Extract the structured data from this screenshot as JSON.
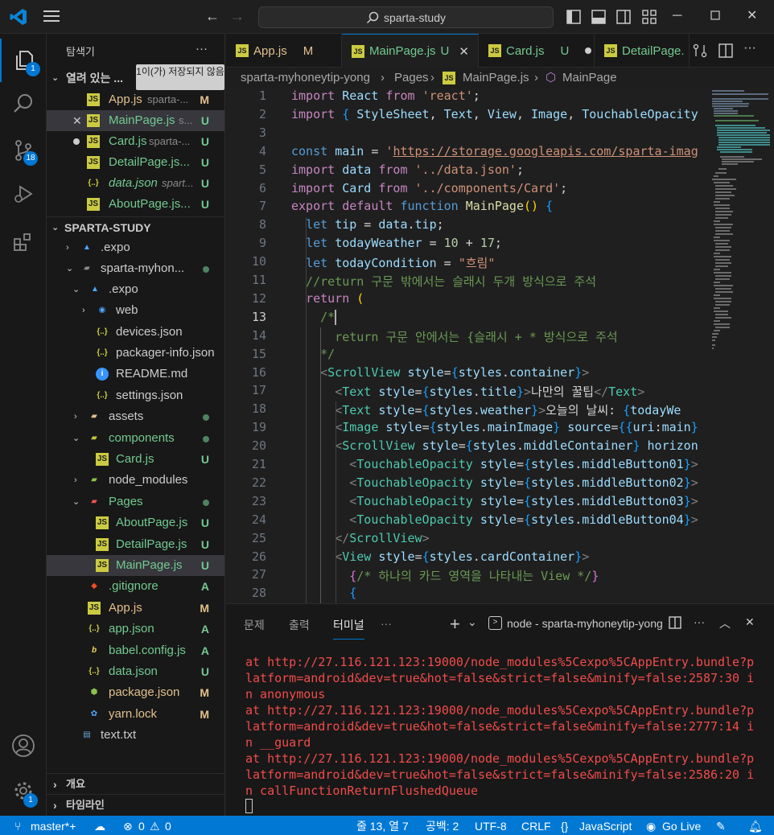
{
  "titlebar": {
    "search": "sparta-study"
  },
  "activity": {
    "explorer_badge": "1",
    "scm_badge": "18",
    "settings_badge": "1"
  },
  "sidebar": {
    "title": "탐색기",
    "more": "···",
    "open_editors": "열려 있는 ...",
    "unsaved_tooltip": "1이(가) 저장되지 않음",
    "open_items": [
      {
        "name": "App.js",
        "path": "sparta-...",
        "status": "M"
      },
      {
        "name": "MainPage.js",
        "path": "s...",
        "status": "U"
      },
      {
        "name": "Card.js",
        "path": "sparta-...",
        "status": "U"
      },
      {
        "name": "DetailPage.js...",
        "path": "",
        "status": "U"
      },
      {
        "name": "data.json",
        "path": "spart...",
        "status": "U"
      },
      {
        "name": "AboutPage.js...",
        "path": "",
        "status": "U"
      }
    ],
    "project": "SPARTA-STUDY",
    "tree": [
      {
        "name": ".expo",
        "status": ""
      },
      {
        "name": "sparta-myhon...",
        "status": ""
      },
      {
        "name": ".expo",
        "status": ""
      },
      {
        "name": "web",
        "status": ""
      },
      {
        "name": "devices.json",
        "status": ""
      },
      {
        "name": "packager-info.json",
        "status": ""
      },
      {
        "name": "README.md",
        "status": ""
      },
      {
        "name": "settings.json",
        "status": ""
      },
      {
        "name": "assets",
        "status": ""
      },
      {
        "name": "components",
        "status": ""
      },
      {
        "name": "Card.js",
        "status": "U"
      },
      {
        "name": "node_modules",
        "status": ""
      },
      {
        "name": "Pages",
        "status": ""
      },
      {
        "name": "AboutPage.js",
        "status": "U"
      },
      {
        "name": "DetailPage.js",
        "status": "U"
      },
      {
        "name": "MainPage.js",
        "status": "U"
      },
      {
        "name": ".gitignore",
        "status": "A"
      },
      {
        "name": "App.js",
        "status": "M"
      },
      {
        "name": "app.json",
        "status": "A"
      },
      {
        "name": "babel.config.js",
        "status": "A"
      },
      {
        "name": "data.json",
        "status": "U"
      },
      {
        "name": "package.json",
        "status": "M"
      },
      {
        "name": "yarn.lock",
        "status": "M"
      },
      {
        "name": "text.txt",
        "status": ""
      }
    ],
    "outline": "개요",
    "timeline": "타임라인"
  },
  "tabs": [
    {
      "label": "App.js",
      "status": "M"
    },
    {
      "label": "MainPage.js",
      "status": "U"
    },
    {
      "label": "Card.js",
      "status": "U"
    },
    {
      "label": "DetailPage.",
      "status": ""
    }
  ],
  "breadcrumb": {
    "root": "sparta-myhoneytip-yong",
    "folder": "Pages",
    "file": "MainPage.js",
    "symbol": "MainPage"
  },
  "editor": {
    "line_numbers": [
      "1",
      "2",
      "3",
      "4",
      "5",
      "6",
      "7",
      "8",
      "9",
      "10",
      "11",
      "12",
      "13",
      "14",
      "15",
      "16",
      "17",
      "18",
      "19",
      "20",
      "21",
      "22",
      "23",
      "24",
      "25",
      "26",
      "27",
      "28"
    ],
    "lines": [
      "import React from 'react';",
      "import { StyleSheet, Text, View, Image, TouchableOpacity",
      "",
      "const main = 'https://storage.googleapis.com/sparta-imag",
      "import data from '../data.json';",
      "import Card from '../components/Card';",
      "export default function MainPage() {",
      "  let tip = data.tip;",
      "  let todayWeather = 10 + 17;",
      "  let todayCondition = \"흐림\"",
      "  //return 구문 밖에서는 슬래시 두개 방식으로 주석",
      "  return (",
      "    /*",
      "      return 구문 안에서는 {슬래시 + * 방식으로 주석",
      "    */",
      "    <ScrollView style={styles.container}>",
      "      <Text style={styles.title}>나만의 꿀팁</Text>",
      "      <Text style={styles.weather}>오늘의 날씨: {todayWe",
      "      <Image style={styles.mainImage} source={{uri:main}",
      "      <ScrollView style={styles.middleContainer} horizon",
      "        <TouchableOpacity style={styles.middleButton01}>",
      "        <TouchableOpacity style={styles.middleButton02}>",
      "        <TouchableOpacity style={styles.middleButton03}>",
      "        <TouchableOpacity style={styles.middleButton04}>",
      "      </ScrollView>",
      "      <View style={styles.cardContainer}>",
      "        {/* 하나의 카드 영역을 나타내는 View */}",
      "        {"
    ]
  },
  "panel": {
    "tabs": [
      "문제",
      "출력",
      "터미널",
      "···"
    ],
    "terminal_name": "node - sparta-myhoneytip-yong",
    "terminal_lines": [
      "at http://27.116.121.123:19000/node_modules%5Cexpo%5CAppEntry.bundle?p",
      "latform=android&dev=true&hot=false&strict=false&minify=false:2587:30 i",
      "n anonymous",
      "at http://27.116.121.123:19000/node_modules%5Cexpo%5CAppEntry.bundle?p",
      "latform=android&dev=true&hot=false&strict=false&minify=false:2777:14 i",
      "n __guard",
      "at http://27.116.121.123:19000/node_modules%5Cexpo%5CAppEntry.bundle?p",
      "latform=android&dev=true&hot=false&strict=false&minify=false:2586:20 i",
      "n callFunctionReturnFlushedQueue"
    ]
  },
  "status": {
    "branch": "master*+",
    "errors": "0",
    "warnings": "0",
    "position": "줄 13, 열 7",
    "spaces": "공백: 2",
    "encoding": "UTF-8",
    "eol": "CRLF",
    "language": "JavaScript",
    "golive": "Go Live"
  },
  "colors": {
    "accent": "#0078d4",
    "modified": "#e2c08d",
    "untracked": "#73c991",
    "error": "#f14c4c"
  }
}
